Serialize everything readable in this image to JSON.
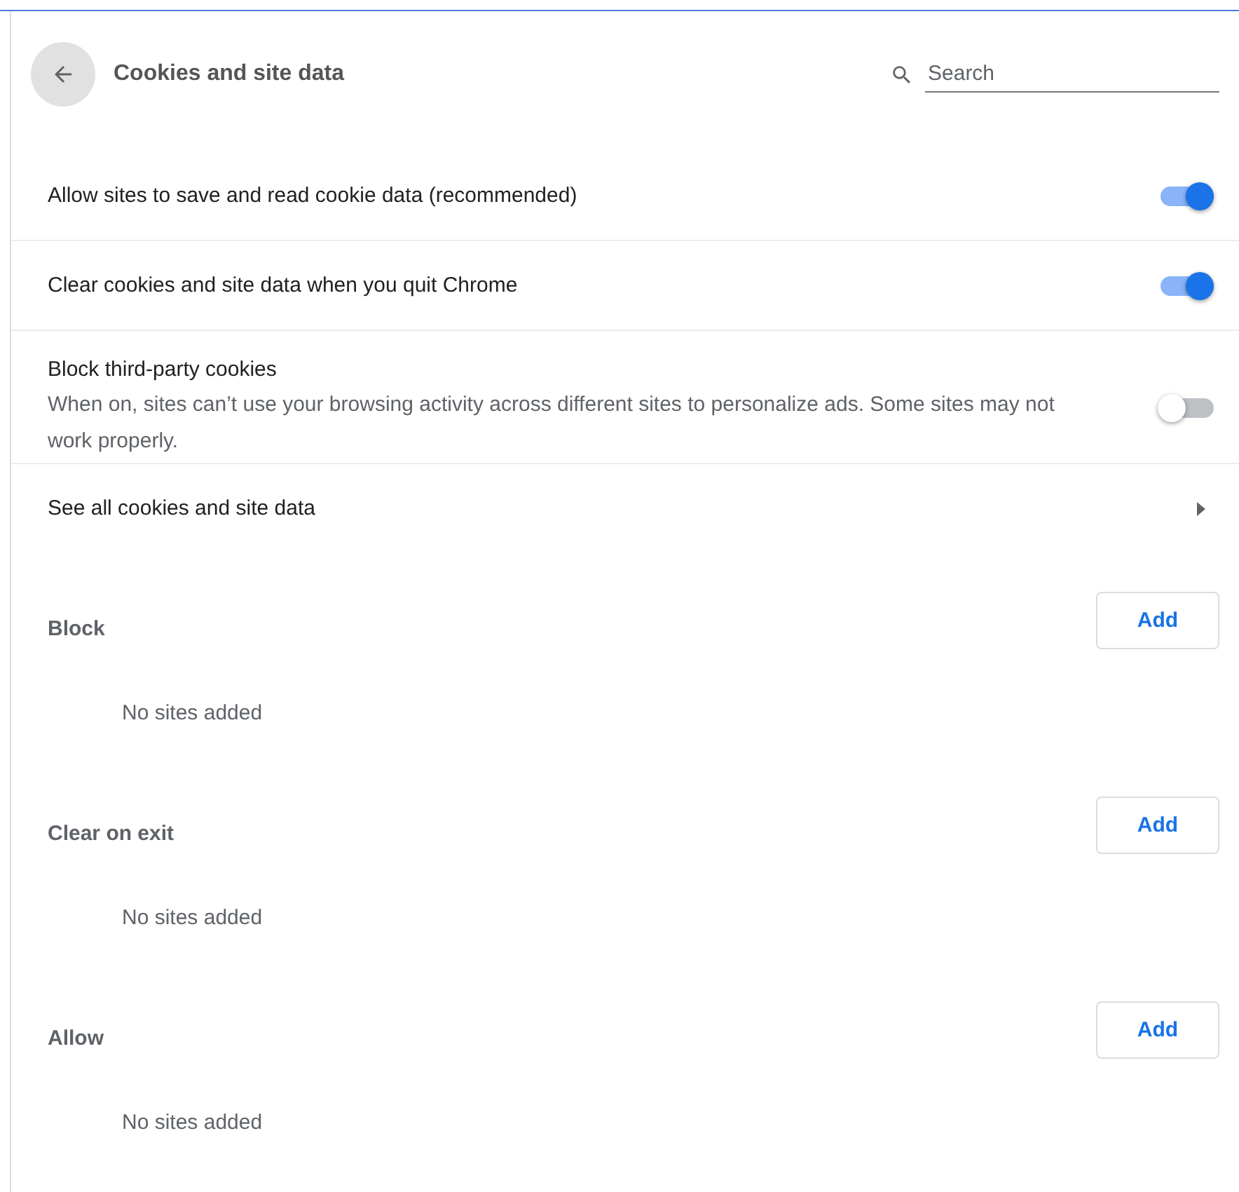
{
  "header": {
    "title": "Cookies and site data",
    "search": {
      "placeholder": "Search"
    }
  },
  "settings": [
    {
      "kind": "toggle",
      "label": "Allow sites to save and read cookie data (recommended)",
      "on": true
    },
    {
      "kind": "toggle",
      "label": "Clear cookies and site data when you quit Chrome",
      "on": true
    },
    {
      "kind": "toggle",
      "label": "Block third-party cookies",
      "description": "When on, sites can’t use your browsing activity across different sites to personalize ads. Some sites may not work properly.",
      "on": false
    },
    {
      "kind": "link",
      "label": "See all cookies and site data"
    }
  ],
  "sections": [
    {
      "title": "Block",
      "button": "Add",
      "empty": "No sites added"
    },
    {
      "title": "Clear on exit",
      "button": "Add",
      "empty": "No sites added"
    },
    {
      "title": "Allow",
      "button": "Add",
      "empty": "No sites added"
    }
  ]
}
